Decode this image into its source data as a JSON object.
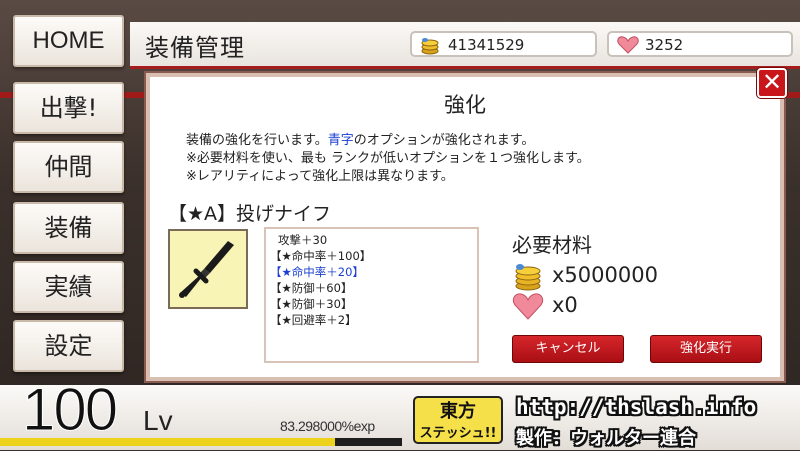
{
  "header": {
    "title": "装備管理",
    "gold": "41341529",
    "hearts": "3252"
  },
  "nav": [
    {
      "label": "HOME",
      "icon": "home"
    },
    {
      "label": "出撃!",
      "icon": "sortie"
    },
    {
      "label": "仲間",
      "icon": "party"
    },
    {
      "label": "装備",
      "icon": "equipment"
    },
    {
      "label": "実績",
      "icon": "achievements"
    },
    {
      "label": "設定",
      "icon": "settings"
    }
  ],
  "dialog": {
    "title": "強化",
    "desc_line1_pre": "装備の強化を行います。",
    "desc_line1_blue": "青字",
    "desc_line1_post": "のオプションが強化されます。",
    "desc_line2": "※必要材料を使い、最も ランクが低いオプションを１つ強化します。",
    "desc_line3": "※レアリティによって強化上限は異なります。",
    "item_name": "【★A】投げナイフ",
    "item_icon": "knife-icon",
    "options": [
      {
        "text": "攻撃＋30",
        "highlight": false
      },
      {
        "text": "【★命中率＋100】",
        "highlight": false
      },
      {
        "text": "【★命中率＋20】",
        "highlight": true
      },
      {
        "text": "【★防御＋60】",
        "highlight": false
      },
      {
        "text": "【★防御＋30】",
        "highlight": false
      },
      {
        "text": "【★回避率＋2】",
        "highlight": false
      }
    ],
    "required_title": "必要材料",
    "gold_cost": "x5000000",
    "heart_cost": "x0",
    "cancel_label": "キャンセル",
    "execute_label": "強化実行",
    "close_label": "✕"
  },
  "status": {
    "level": "100",
    "level_unit": "Lv",
    "exp_text": "83.298000%exp",
    "exp_fraction": 0.83298
  },
  "footer": {
    "logo_text": "東方 ステッシュ!!",
    "site_url": "http://thslash.info",
    "credit": "製作：ウォルター連合"
  },
  "colors": {
    "accent_red": "#c8161b",
    "highlight_blue": "#1a3fd1",
    "exp_fill": "#ecd21a"
  }
}
